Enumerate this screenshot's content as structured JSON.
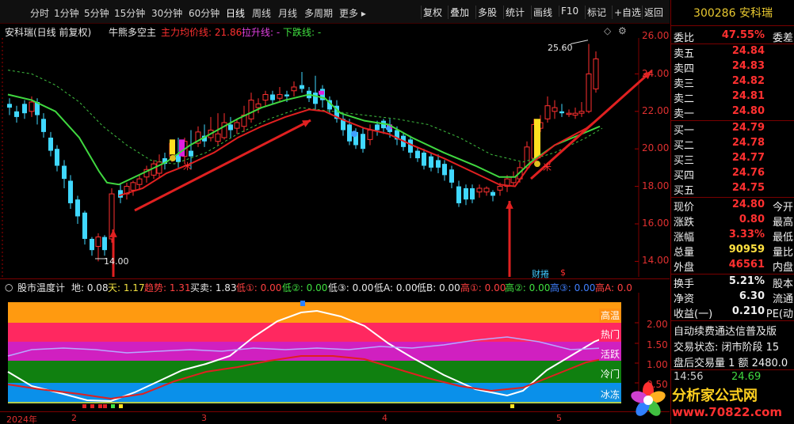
{
  "toolbar": {
    "periods": [
      "分时",
      "1分钟",
      "5分钟",
      "15分钟",
      "30分钟",
      "60分钟",
      "日线",
      "周线",
      "月线",
      "多周期",
      "更多 ▸"
    ],
    "active_period": "日线",
    "right_buttons": [
      "复权",
      "叠加",
      "多股",
      "统计",
      "画线",
      "F10",
      "标记",
      "+自选",
      "返回"
    ]
  },
  "main_panel": {
    "title": "安科瑞(日线 前复权)",
    "indicator_name": "牛熊多空主",
    "main_line_label": "主力均价线: 21.86",
    "up_line_label": "拉升线: -",
    "down_line_label": "下跌线: -",
    "price_axis": [
      "26.00",
      "24.00",
      "22.00",
      "20.00",
      "18.00",
      "16.00",
      "14.00"
    ],
    "high_marker": "25.60",
    "low_marker": "14.00",
    "tags": {
      "caicang": "财捲",
      "s_mark": "$",
      "mi_left": "米",
      "mi_right": "米"
    }
  },
  "sub_panel": {
    "title": "股市温度计",
    "values": [
      {
        "label": "地: 0.08",
        "color": "#e8e8e8"
      },
      {
        "label": "天: 1.17",
        "color": "#f0e040"
      },
      {
        "label": "趋势: 1.31",
        "color": "#ff4040"
      },
      {
        "label": "买卖: 1.83",
        "color": "#e8e8e8"
      },
      {
        "label": "低①: 0.00",
        "color": "#ff4040"
      },
      {
        "label": "低②: 0.00",
        "color": "#40e040"
      },
      {
        "label": "低③: 0.00",
        "color": "#e8e8e8"
      },
      {
        "label": "低A: 0.00",
        "color": "#e8e8e8"
      },
      {
        "label": "低B: 0.00",
        "color": "#e8e8e8"
      },
      {
        "label": "高①: 0.00",
        "color": "#ff4040"
      },
      {
        "label": "高②: 0.00",
        "color": "#40e040"
      },
      {
        "label": "高③: 0.00",
        "color": "#4080ff"
      },
      {
        "label": "高A: 0.0",
        "color": "#ff4040"
      }
    ],
    "zones": [
      "高温",
      "热门",
      "活跃",
      "冷门",
      "冰冻"
    ],
    "axis": [
      "2.00",
      "1.50",
      "1.00",
      "0.50"
    ],
    "dates": [
      "2024年",
      "2",
      "3",
      "4",
      "5"
    ]
  },
  "quote": {
    "code_name": "300286 安科瑞",
    "ratio": {
      "label": "委比",
      "value": "47.55%",
      "label2": "委差"
    },
    "asks": [
      {
        "label": "卖五",
        "value": "24.84"
      },
      {
        "label": "卖四",
        "value": "24.83"
      },
      {
        "label": "卖三",
        "value": "24.82"
      },
      {
        "label": "卖二",
        "value": "24.81"
      },
      {
        "label": "卖一",
        "value": "24.80"
      }
    ],
    "bids": [
      {
        "label": "买一",
        "value": "24.79"
      },
      {
        "label": "买二",
        "value": "24.78"
      },
      {
        "label": "买三",
        "value": "24.77"
      },
      {
        "label": "买四",
        "value": "24.76"
      },
      {
        "label": "买五",
        "value": "24.75"
      }
    ],
    "stats": [
      {
        "label": "现价",
        "value": "24.80",
        "label2": "今开"
      },
      {
        "label": "涨跌",
        "value": "0.80",
        "label2": "最高"
      },
      {
        "label": "涨幅",
        "value": "3.33%",
        "label2": "最低"
      },
      {
        "label": "总量",
        "value": "90959",
        "label2": "量比"
      },
      {
        "label": "外盘",
        "value": "46561",
        "label2": "内盘"
      }
    ],
    "stats2": [
      {
        "label": "换手",
        "value": "5.21%",
        "label2": "股本"
      },
      {
        "label": "净资",
        "value": "6.30",
        "label2": "流通"
      },
      {
        "label": "收益(一)",
        "value": "0.210",
        "label2": "PE(动"
      }
    ],
    "footer_lines": [
      "自动续费通达信普及版",
      "交易状态: 闭市阶段 15",
      "盘后交易量 1 额 2480.0"
    ],
    "tick": {
      "time": "14:56",
      "price": "24.69"
    }
  },
  "watermark": {
    "brand": "分析家公式网",
    "site": "www.70822.com"
  },
  "colors": {
    "up": "#ff3030",
    "down": "#40d8ff",
    "ma_green": "#40d840",
    "ma_red": "#e02020"
  }
}
